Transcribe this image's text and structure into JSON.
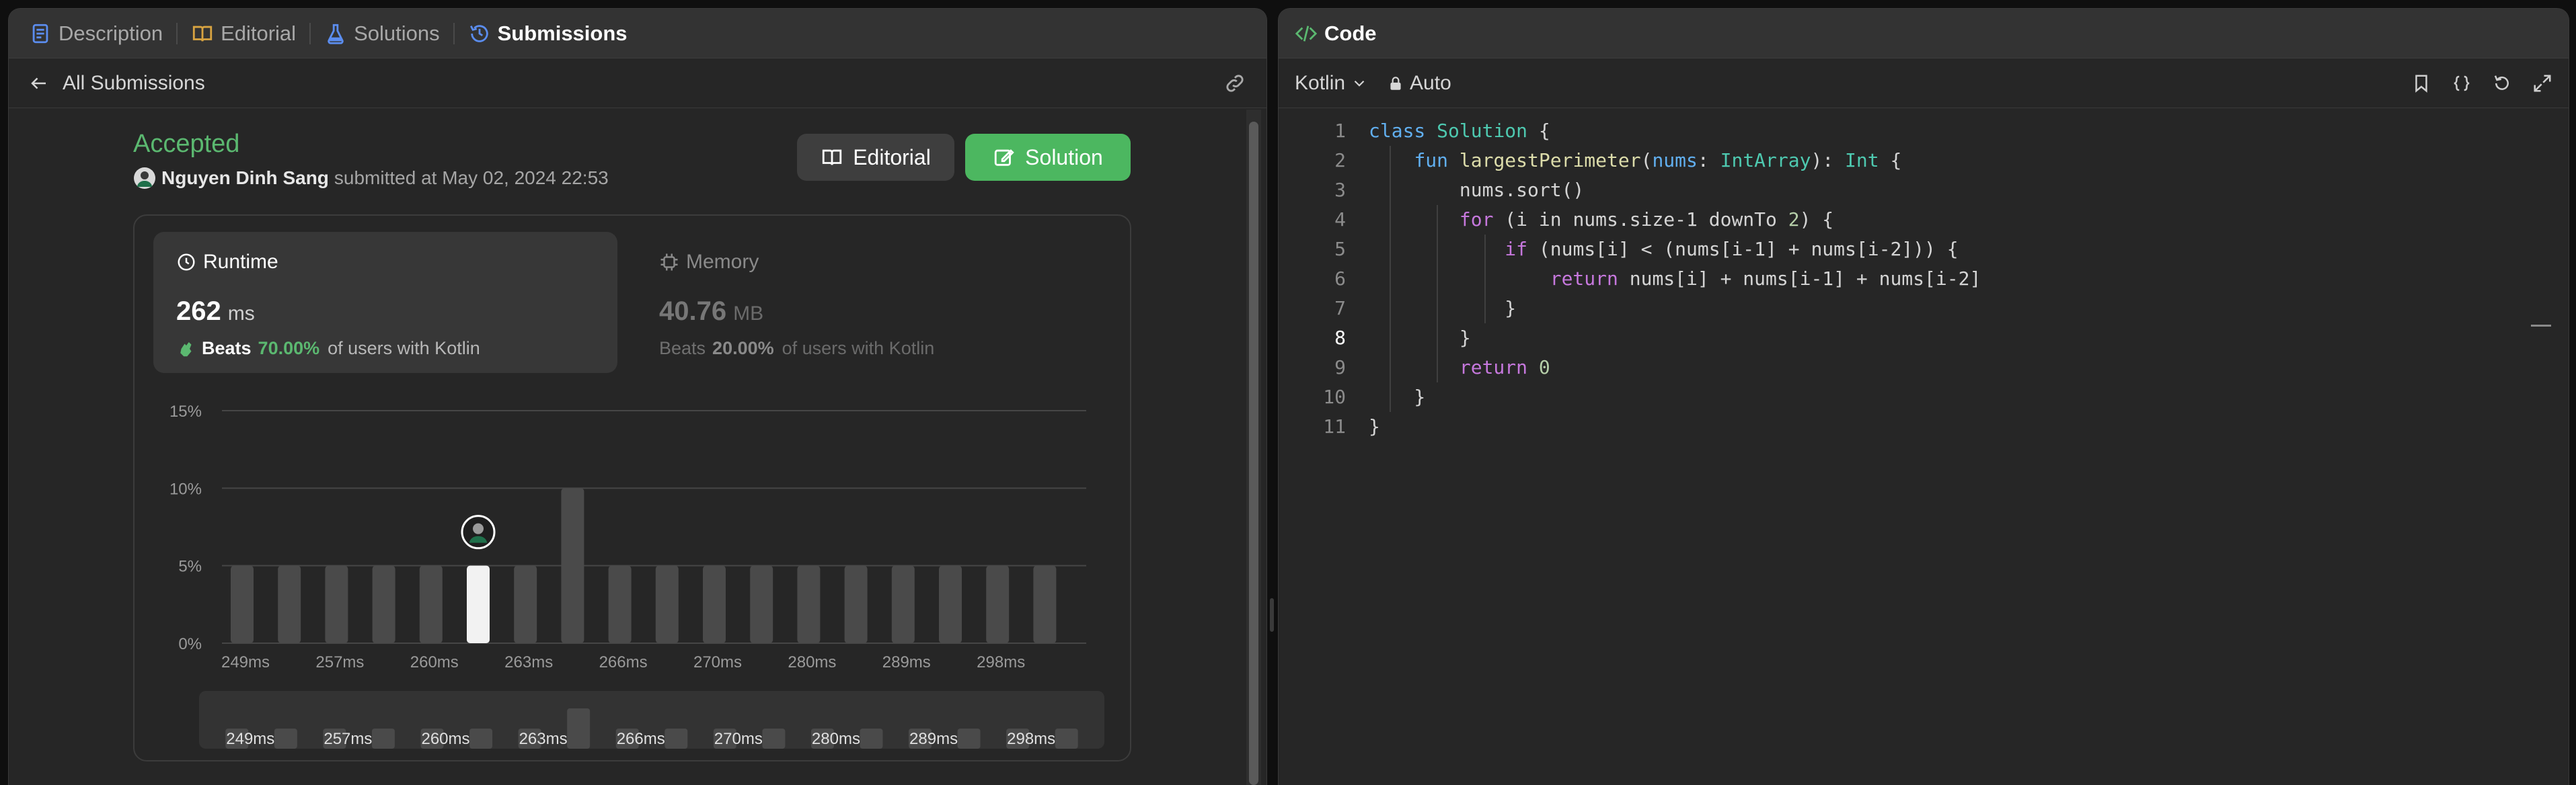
{
  "left_tabs": [
    {
      "label": "Description",
      "icon": "document-icon",
      "active": false
    },
    {
      "label": "Editorial",
      "icon": "book-icon",
      "active": false
    },
    {
      "label": "Solutions",
      "icon": "flask-icon",
      "active": false
    },
    {
      "label": "Submissions",
      "icon": "history-icon",
      "active": true
    }
  ],
  "back_label": "All Submissions",
  "submission": {
    "status": "Accepted",
    "user": "Nguyen Dinh Sang",
    "submitted_text": "submitted at May 02, 2024 22:53",
    "editorial_button": "Editorial",
    "solution_button": "Solution"
  },
  "runtime": {
    "title": "Runtime",
    "value": "262",
    "unit": "ms",
    "beats_label": "Beats",
    "beats_pct": "70.00%",
    "beats_rest": "of users with Kotlin"
  },
  "memory": {
    "title": "Memory",
    "value": "40.76",
    "unit": "MB",
    "beats_label": "Beats",
    "beats_pct": "20.00%",
    "beats_rest": "of users with Kotlin"
  },
  "chart_data": {
    "type": "bar",
    "y_ticks": [
      "15%",
      "10%",
      "5%",
      "0%"
    ],
    "ylim": [
      0,
      15
    ],
    "values": [
      5,
      5,
      5,
      5,
      5,
      5,
      5,
      10,
      5,
      5,
      5,
      5,
      5,
      5,
      5,
      5,
      5,
      5
    ],
    "highlight_index": 5,
    "x_tick_labels": [
      "249ms",
      "257ms",
      "260ms",
      "263ms",
      "266ms",
      "270ms",
      "280ms",
      "289ms",
      "298ms"
    ],
    "overview_labels": [
      "249ms",
      "257ms",
      "260ms",
      "263ms",
      "266ms",
      "270ms",
      "280ms",
      "289ms",
      "298ms"
    ],
    "colors": {
      "bar": "#4a4a4a",
      "highlight": "#f2f2f2",
      "grid": "#464646"
    }
  },
  "code_panel": {
    "title": "Code",
    "language": "Kotlin",
    "mode": "Auto",
    "line_numbers": [
      "1",
      "2",
      "3",
      "4",
      "5",
      "6",
      "7",
      "8",
      "9",
      "10",
      "11"
    ],
    "current_line": "8",
    "lines": [
      "class Solution {",
      "    fun largestPerimeter(nums: IntArray): Int {",
      "        nums.sort()",
      "        for (i in nums.size-1 downTo 2) {",
      "            if (nums[i] < (nums[i-1] + nums[i-2])) {",
      "                return nums[i] + nums[i-1] + nums[i-2]",
      "            }",
      "        }",
      "        return 0",
      "    }",
      "}"
    ]
  }
}
